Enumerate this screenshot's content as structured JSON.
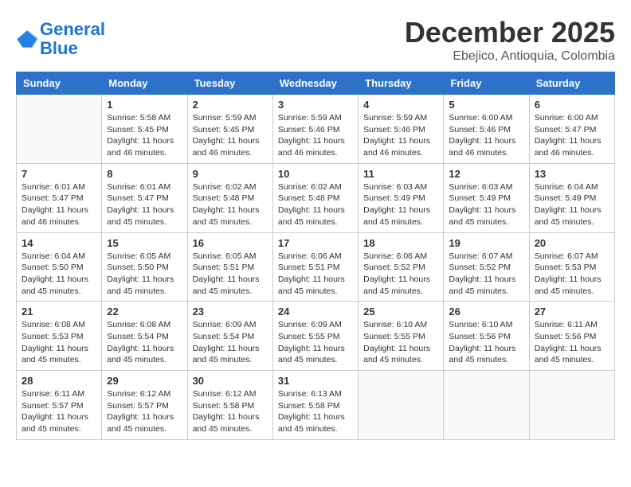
{
  "header": {
    "logo_line1": "General",
    "logo_line2": "Blue",
    "month": "December 2025",
    "location": "Ebejico, Antioquia, Colombia"
  },
  "weekdays": [
    "Sunday",
    "Monday",
    "Tuesday",
    "Wednesday",
    "Thursday",
    "Friday",
    "Saturday"
  ],
  "weeks": [
    [
      {
        "day": "",
        "sunrise": "",
        "sunset": "",
        "daylight": ""
      },
      {
        "day": "1",
        "sunrise": "5:58 AM",
        "sunset": "5:45 PM",
        "daylight": "11 hours and 46 minutes."
      },
      {
        "day": "2",
        "sunrise": "5:59 AM",
        "sunset": "5:45 PM",
        "daylight": "11 hours and 46 minutes."
      },
      {
        "day": "3",
        "sunrise": "5:59 AM",
        "sunset": "5:46 PM",
        "daylight": "11 hours and 46 minutes."
      },
      {
        "day": "4",
        "sunrise": "5:59 AM",
        "sunset": "5:46 PM",
        "daylight": "11 hours and 46 minutes."
      },
      {
        "day": "5",
        "sunrise": "6:00 AM",
        "sunset": "5:46 PM",
        "daylight": "11 hours and 46 minutes."
      },
      {
        "day": "6",
        "sunrise": "6:00 AM",
        "sunset": "5:47 PM",
        "daylight": "11 hours and 46 minutes."
      }
    ],
    [
      {
        "day": "7",
        "sunrise": "6:01 AM",
        "sunset": "5:47 PM",
        "daylight": "11 hours and 46 minutes."
      },
      {
        "day": "8",
        "sunrise": "6:01 AM",
        "sunset": "5:47 PM",
        "daylight": "11 hours and 45 minutes."
      },
      {
        "day": "9",
        "sunrise": "6:02 AM",
        "sunset": "5:48 PM",
        "daylight": "11 hours and 45 minutes."
      },
      {
        "day": "10",
        "sunrise": "6:02 AM",
        "sunset": "5:48 PM",
        "daylight": "11 hours and 45 minutes."
      },
      {
        "day": "11",
        "sunrise": "6:03 AM",
        "sunset": "5:49 PM",
        "daylight": "11 hours and 45 minutes."
      },
      {
        "day": "12",
        "sunrise": "6:03 AM",
        "sunset": "5:49 PM",
        "daylight": "11 hours and 45 minutes."
      },
      {
        "day": "13",
        "sunrise": "6:04 AM",
        "sunset": "5:49 PM",
        "daylight": "11 hours and 45 minutes."
      }
    ],
    [
      {
        "day": "14",
        "sunrise": "6:04 AM",
        "sunset": "5:50 PM",
        "daylight": "11 hours and 45 minutes."
      },
      {
        "day": "15",
        "sunrise": "6:05 AM",
        "sunset": "5:50 PM",
        "daylight": "11 hours and 45 minutes."
      },
      {
        "day": "16",
        "sunrise": "6:05 AM",
        "sunset": "5:51 PM",
        "daylight": "11 hours and 45 minutes."
      },
      {
        "day": "17",
        "sunrise": "6:06 AM",
        "sunset": "5:51 PM",
        "daylight": "11 hours and 45 minutes."
      },
      {
        "day": "18",
        "sunrise": "6:06 AM",
        "sunset": "5:52 PM",
        "daylight": "11 hours and 45 minutes."
      },
      {
        "day": "19",
        "sunrise": "6:07 AM",
        "sunset": "5:52 PM",
        "daylight": "11 hours and 45 minutes."
      },
      {
        "day": "20",
        "sunrise": "6:07 AM",
        "sunset": "5:53 PM",
        "daylight": "11 hours and 45 minutes."
      }
    ],
    [
      {
        "day": "21",
        "sunrise": "6:08 AM",
        "sunset": "5:53 PM",
        "daylight": "11 hours and 45 minutes."
      },
      {
        "day": "22",
        "sunrise": "6:08 AM",
        "sunset": "5:54 PM",
        "daylight": "11 hours and 45 minutes."
      },
      {
        "day": "23",
        "sunrise": "6:09 AM",
        "sunset": "5:54 PM",
        "daylight": "11 hours and 45 minutes."
      },
      {
        "day": "24",
        "sunrise": "6:09 AM",
        "sunset": "5:55 PM",
        "daylight": "11 hours and 45 minutes."
      },
      {
        "day": "25",
        "sunrise": "6:10 AM",
        "sunset": "5:55 PM",
        "daylight": "11 hours and 45 minutes."
      },
      {
        "day": "26",
        "sunrise": "6:10 AM",
        "sunset": "5:56 PM",
        "daylight": "11 hours and 45 minutes."
      },
      {
        "day": "27",
        "sunrise": "6:11 AM",
        "sunset": "5:56 PM",
        "daylight": "11 hours and 45 minutes."
      }
    ],
    [
      {
        "day": "28",
        "sunrise": "6:11 AM",
        "sunset": "5:57 PM",
        "daylight": "11 hours and 45 minutes."
      },
      {
        "day": "29",
        "sunrise": "6:12 AM",
        "sunset": "5:57 PM",
        "daylight": "11 hours and 45 minutes."
      },
      {
        "day": "30",
        "sunrise": "6:12 AM",
        "sunset": "5:58 PM",
        "daylight": "11 hours and 45 minutes."
      },
      {
        "day": "31",
        "sunrise": "6:13 AM",
        "sunset": "5:58 PM",
        "daylight": "11 hours and 45 minutes."
      },
      {
        "day": "",
        "sunrise": "",
        "sunset": "",
        "daylight": ""
      },
      {
        "day": "",
        "sunrise": "",
        "sunset": "",
        "daylight": ""
      },
      {
        "day": "",
        "sunrise": "",
        "sunset": "",
        "daylight": ""
      }
    ]
  ]
}
